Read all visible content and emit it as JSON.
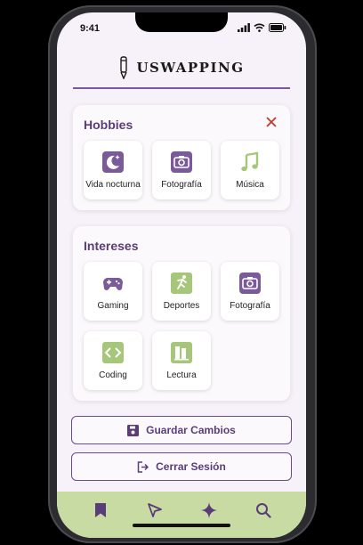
{
  "status_bar": {
    "time": "9:41"
  },
  "header": {
    "app_name": "USWAPPING"
  },
  "hobbies": {
    "title": "Hobbies",
    "items": [
      {
        "label": "Vida nocturna",
        "icon": "moon-icon"
      },
      {
        "label": "Fotografía",
        "icon": "camera-icon"
      },
      {
        "label": "Música",
        "icon": "music-note-icon"
      }
    ]
  },
  "intereses": {
    "title": "Intereses",
    "items": [
      {
        "label": "Gaming",
        "icon": "gamepad-icon"
      },
      {
        "label": "Deportes",
        "icon": "running-icon"
      },
      {
        "label": "Fotografía",
        "icon": "camera-icon"
      },
      {
        "label": "Coding",
        "icon": "code-icon"
      },
      {
        "label": "Lectura",
        "icon": "book-icon"
      }
    ]
  },
  "actions": {
    "save_label": "Guardar Cambios",
    "logout_label": "Cerrar Sesión"
  },
  "bottom_nav": [
    "bookmark-icon",
    "send-icon",
    "sparkle-icon",
    "search-icon"
  ],
  "colors": {
    "accent_purple": "#7a5a98",
    "icon_green": "#a6c77a",
    "nav_green": "#c7dba3",
    "close_red": "#c0392b"
  }
}
